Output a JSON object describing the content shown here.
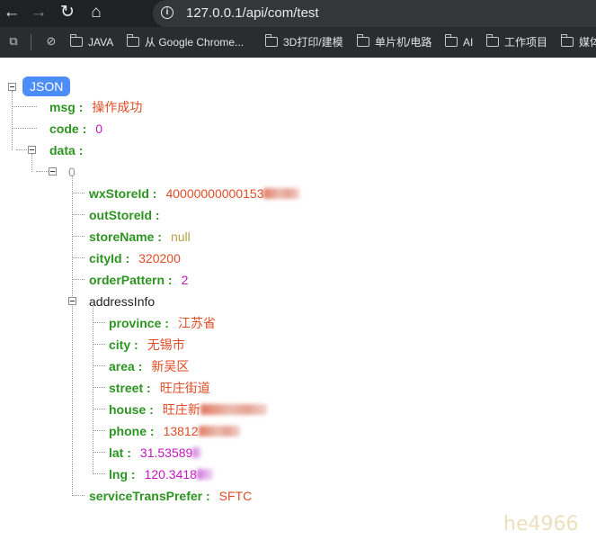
{
  "browser": {
    "nav": {
      "back_icon": "←",
      "forward_icon": "→",
      "reload_icon": "↻",
      "home_icon": "⌂"
    },
    "url": "127.0.0.1/api/com/test",
    "bookmarks": [
      "JAVA",
      "从 Google Chrome...",
      "3D打印/建模",
      "单片机/电路",
      "AI",
      "工作项目",
      "媒体"
    ]
  },
  "viewer": {
    "root_label": "JSON",
    "separator": ":",
    "fields": {
      "msg": {
        "key": "msg",
        "value": "操作成功"
      },
      "code": {
        "key": "code",
        "value": "0"
      },
      "data": {
        "key": "data"
      }
    },
    "item_index": "0",
    "item": {
      "wxStoreId": {
        "key": "wxStoreId",
        "value": "40000000000153"
      },
      "outStoreId": {
        "key": "outStoreId"
      },
      "storeName": {
        "key": "storeName",
        "value": "null"
      },
      "cityId": {
        "key": "cityId",
        "value": "320200"
      },
      "orderPattern": {
        "key": "orderPattern",
        "value": "2"
      },
      "addressInfo": {
        "key": "addressInfo"
      },
      "serviceTransPrefer": {
        "key": "serviceTransPrefer",
        "value": "SFTC"
      }
    },
    "address": {
      "province": {
        "key": "province",
        "value": "江苏省"
      },
      "city": {
        "key": "city",
        "value": "无锡市"
      },
      "area": {
        "key": "area",
        "value": "新吴区"
      },
      "street": {
        "key": "street",
        "value": "旺庄街道"
      },
      "house": {
        "key": "house",
        "value": "旺庄新"
      },
      "phone": {
        "key": "phone",
        "value": "13812"
      },
      "lat": {
        "key": "lat",
        "value": "31.53589"
      },
      "lng": {
        "key": "lng",
        "value": "120.3418"
      }
    }
  },
  "watermark": "he4966",
  "colors": {
    "key": "#2c9420",
    "string": "#e04c26",
    "number": "#c218c2",
    "null": "#b7a040",
    "badge": "#4d8df7"
  }
}
